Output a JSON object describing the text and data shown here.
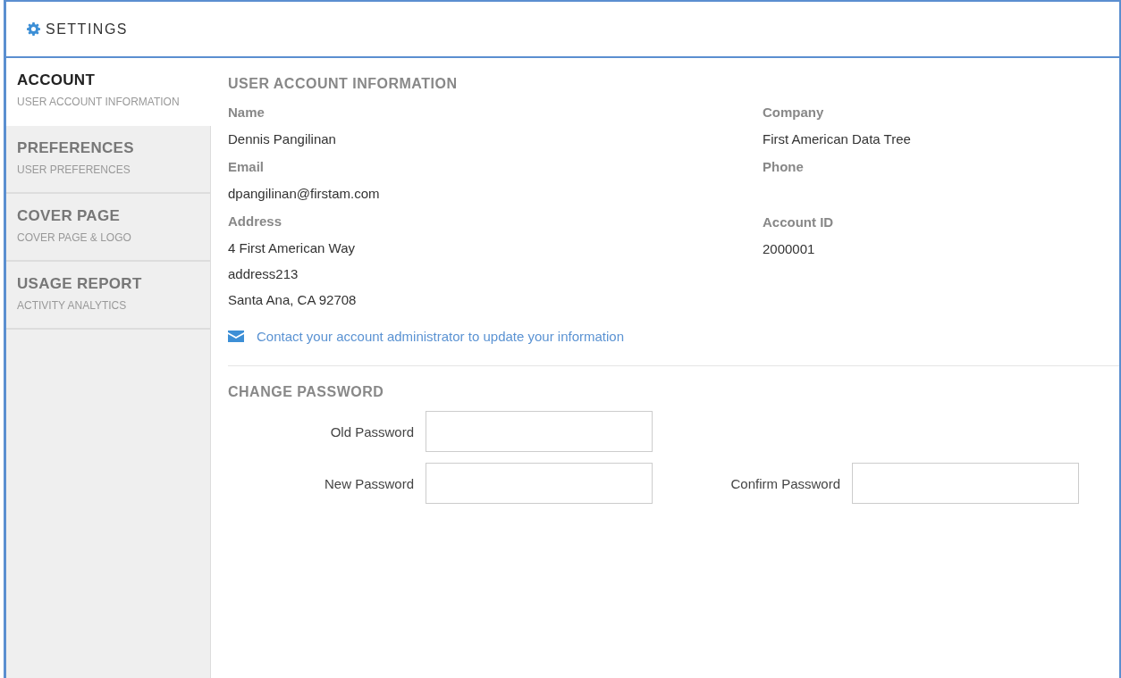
{
  "window": {
    "title": "SETTINGS"
  },
  "sidebar": {
    "items": [
      {
        "title": "ACCOUNT",
        "subtitle": "USER ACCOUNT INFORMATION",
        "selected": true
      },
      {
        "title": "PREFERENCES",
        "subtitle": "USER PREFERENCES",
        "selected": false
      },
      {
        "title": "COVER PAGE",
        "subtitle": "COVER PAGE & LOGO",
        "selected": false
      },
      {
        "title": "USAGE REPORT",
        "subtitle": "ACTIVITY ANALYTICS",
        "selected": false
      }
    ]
  },
  "account": {
    "heading": "USER ACCOUNT INFORMATION",
    "columns": [
      [
        {
          "label": "Name",
          "values": [
            "Dennis Pangilinan"
          ]
        },
        {
          "label": "Email",
          "values": [
            "dpangilinan@firstam.com"
          ]
        },
        {
          "label": "Address",
          "values": [
            "4 First American Way",
            "address213",
            "Santa Ana, CA 92708"
          ]
        }
      ],
      [
        {
          "label": "Company",
          "values": [
            "First American Data Tree"
          ]
        },
        {
          "label": "Phone"
        },
        {
          "label": "Account ID",
          "values": [
            "2000001"
          ]
        }
      ]
    ],
    "contact_link": "Contact your account administrator to update your information"
  },
  "change_password": {
    "heading": "CHANGE PASSWORD",
    "rows": [
      [
        {
          "label": "Old Password"
        }
      ],
      [
        {
          "label": "New Password"
        },
        {
          "label": "Confirm Password"
        }
      ]
    ]
  }
}
